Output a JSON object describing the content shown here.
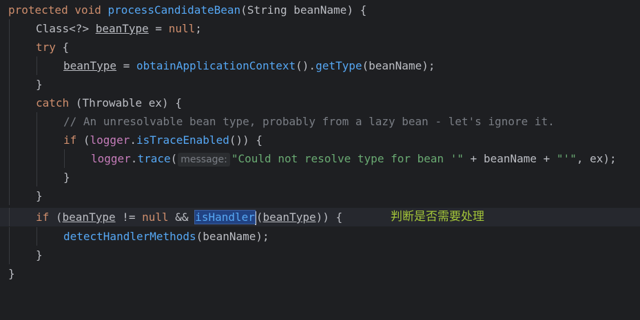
{
  "editor": {
    "lines": [
      "protected void processCandidateBean(String beanName) {",
      "Class<?> beanType = null;",
      "try {",
      "beanType = obtainApplicationContext().getType(beanName);",
      "}",
      "catch (Throwable ex) {",
      "// An unresolvable bean type, probably from a lazy bean - let's ignore it.",
      "if (logger.isTraceEnabled()) {",
      "logger.trace( message: \"Could not resolve type for bean '\" + beanName + \"'\", ex);",
      "}",
      "}",
      "if (beanType != null && isHandler(beanType)) {",
      "detectHandlerMethods(beanName);",
      "}",
      "}"
    ],
    "tokens": {
      "protected": "protected",
      "void": "void",
      "method_name": "processCandidateBean",
      "string_type": "String",
      "bean_name": "beanName",
      "class_type": "Class",
      "wildcard": "<?>",
      "bean_type": "beanType",
      "null_kw": "null",
      "try_kw": "try",
      "obtain": "obtainApplicationContext",
      "get_type": "getType",
      "catch_kw": "catch",
      "throwable": "Throwable",
      "ex": "ex",
      "comment": "// An unresolvable bean type, probably from a lazy bean - let's ignore it.",
      "if_kw": "if",
      "logger": "logger",
      "is_trace": "isTraceEnabled",
      "trace": "trace",
      "param_hint": "message:",
      "str1": "\"Could not resolve type for bean '\"",
      "str2": "\"'\"",
      "is_handler": "isHandler",
      "detect": "detectHandlerMethods"
    },
    "annotation": "判断是否需要处理"
  },
  "colors": {
    "background": "#1e1f22",
    "current_line": "#26282e",
    "keyword": "#cf8e6d",
    "method": "#56a8f5",
    "field": "#c77dbb",
    "string": "#6aab73",
    "comment": "#7a7e85",
    "annotation": "#a4c639",
    "selection": "#214283"
  }
}
